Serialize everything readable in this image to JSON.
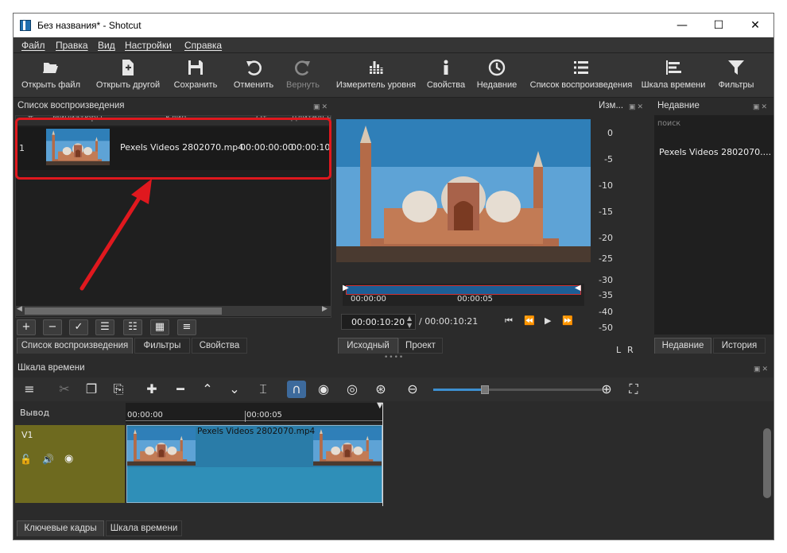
{
  "window": {
    "title": "Без названия* - Shotcut",
    "controls": [
      "minimize-icon",
      "maximize-icon",
      "close-icon"
    ]
  },
  "menu": [
    "Файл",
    "Правка",
    "Вид",
    "Настройки",
    "Справка"
  ],
  "toolbar": {
    "open_file": "Открыть файл",
    "open_other": "Открыть другой",
    "save": "Сохранить",
    "undo": "Отменить",
    "redo": "Вернуть",
    "peak_meter": "Измеритель уровня",
    "properties": "Свойства",
    "recent": "Недавние",
    "playlist": "Список воспроизведения",
    "timeline": "Шкала времени",
    "filters": "Фильтры"
  },
  "playlist": {
    "title": "Список воспроизведения",
    "columns": [
      "#",
      "Миниатюры",
      "Клип",
      "От",
      "Длительность"
    ],
    "rows": [
      {
        "num": "1",
        "clip": "Pexels Videos 2802070.mp4",
        "in": "00:00:00:00",
        "duration": "00:00:10:2"
      }
    ],
    "buttons": [
      "add-icon",
      "remove-icon",
      "update-icon",
      "details-view-icon",
      "tiles-view-icon",
      "icons-view-icon",
      "menu-icon"
    ],
    "tabs": [
      "Список воспроизведения",
      "Фильтры",
      "Свойства"
    ]
  },
  "player": {
    "scrub_marks": [
      "00:00:00",
      "00:00:05"
    ],
    "position": "00:00:10:20",
    "duration": "/ 00:00:10:21",
    "tabs": [
      "Исходный",
      "Проект"
    ]
  },
  "meter": {
    "title": "Изм...",
    "scale": [
      "0",
      "-5",
      "-10",
      "-15",
      "-20",
      "-25",
      "-30",
      "-35",
      "-40",
      "-50"
    ],
    "channels": [
      "L",
      "R"
    ]
  },
  "recent": {
    "title": "Недавние",
    "search_placeholder": "поиск",
    "items": [
      "Pexels Videos 2802070...."
    ],
    "tabs": [
      "Недавние",
      "История"
    ]
  },
  "timeline": {
    "title": "Шкала времени",
    "output_label": "Вывод",
    "ruler": [
      "00:00:00",
      "00:00:05"
    ],
    "track_name": "V1",
    "clip_name": "Pexels Videos 2802070.mp4",
    "bottom_tabs": [
      "Ключевые кадры",
      "Шкала времени"
    ],
    "accent": "#3d6a9c"
  },
  "colors": {
    "annotation_red": "#e0181e",
    "track_color": "#6e6a1f",
    "clip_color": "#2a7ca8"
  }
}
